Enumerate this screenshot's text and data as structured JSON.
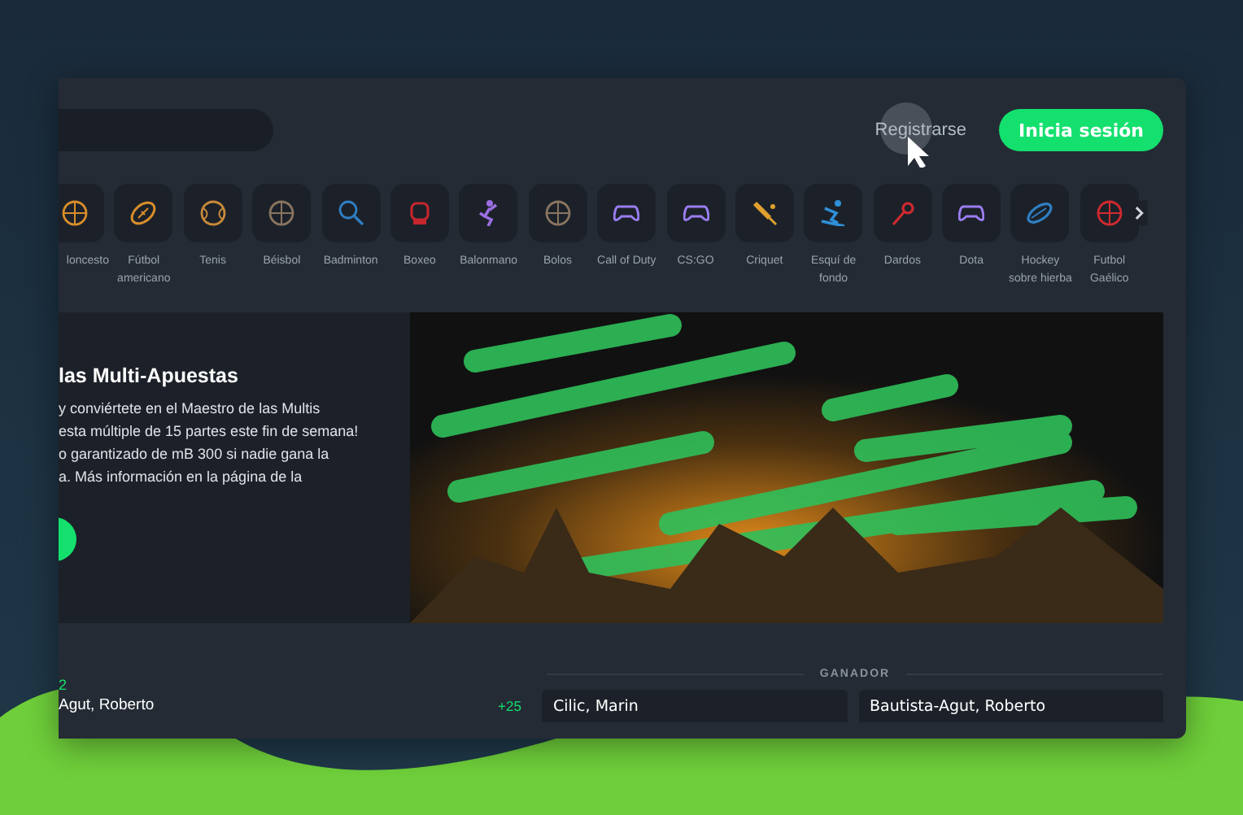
{
  "header": {
    "register_link": "Registrarse",
    "login_button": "Inicia sesión"
  },
  "sports": [
    {
      "label": "loncesto",
      "kind": "ball",
      "color": "#d98e2b"
    },
    {
      "label": "Fútbol americano",
      "kind": "football",
      "color": "#d98e2b"
    },
    {
      "label": "Tenis",
      "kind": "tennis",
      "color": "#c98a3a"
    },
    {
      "label": "Béisbol",
      "kind": "ball",
      "color": "#8a7560"
    },
    {
      "label": "Badminton",
      "kind": "badminton",
      "color": "#2f7fc4"
    },
    {
      "label": "Boxeo",
      "kind": "boxing",
      "color": "#c4262e"
    },
    {
      "label": "Balonmano",
      "kind": "handball",
      "color": "#9a6ee0"
    },
    {
      "label": "Bolos",
      "kind": "ball",
      "color": "#8a7560"
    },
    {
      "label": "Call of Duty",
      "kind": "gamepad",
      "color": "#9a7ef0"
    },
    {
      "label": "CS:GO",
      "kind": "gamepad",
      "color": "#9a7ef0"
    },
    {
      "label": "Criquet",
      "kind": "cricket",
      "color": "#e0a030"
    },
    {
      "label": "Esquí de fondo",
      "kind": "ski",
      "color": "#2f8fd8"
    },
    {
      "label": "Dardos",
      "kind": "darts",
      "color": "#d02a30"
    },
    {
      "label": "Dota",
      "kind": "gamepad",
      "color": "#9a7ef0"
    },
    {
      "label": "Hockey sobre hierba",
      "kind": "puck",
      "color": "#2f7fc4"
    },
    {
      "label": "Futbol Gaélico",
      "kind": "ball",
      "color": "#d02a30"
    }
  ],
  "banner": {
    "title": "las Multi-Apuestas",
    "text": "y conviértete en el Maestro de las Multis\nesta múltiple de 15 partes este fin de semana!\no garantizado de mB 300 si nadie gana la\na. Más información en la página de la"
  },
  "results": {
    "left_count": "2",
    "left_name": "Agut, Roberto",
    "left_odds": "+25",
    "section_label": "GANADOR",
    "options": [
      "Cilic, Marin",
      "Bautista-Agut, Roberto"
    ]
  }
}
